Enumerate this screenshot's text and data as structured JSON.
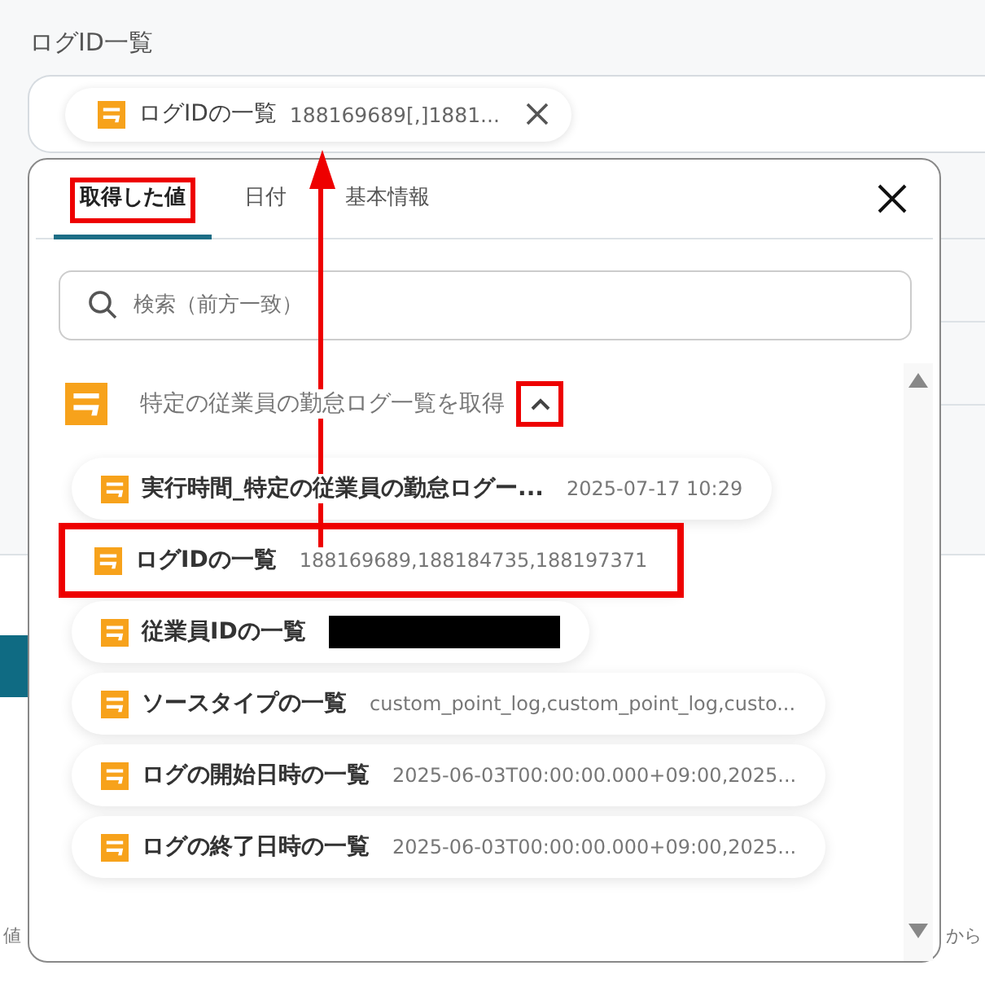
{
  "field": {
    "label": "ログID一覧",
    "chip": {
      "name": "ログIDの一覧",
      "value": "188169689[,]1881..."
    }
  },
  "popup": {
    "tabs": [
      {
        "label": "取得した値",
        "selected": true,
        "highlighted": true
      },
      {
        "label": "日付",
        "selected": false,
        "highlighted": false
      },
      {
        "label": "基本情報",
        "selected": false,
        "highlighted": false
      }
    ],
    "search": {
      "placeholder": "検索（前方一致）"
    },
    "group": {
      "title": "特定の従業員の勤怠ログ一覧を取得",
      "expanded": true,
      "highlighted": true
    },
    "items": [
      {
        "kind": "text",
        "name": "実行時間_特定の従業員の勤怠ログー...",
        "value": "2025-07-17 10:29",
        "highlighted": false
      },
      {
        "kind": "text",
        "name": "ログIDの一覧",
        "value": "188169689,188184735,188197371",
        "highlighted": true
      },
      {
        "kind": "redacted",
        "name": "従業員IDの一覧",
        "highlighted": false
      },
      {
        "kind": "text",
        "name": "ソースタイプの一覧",
        "value": "custom_point_log,custom_point_log,custo...",
        "highlighted": false
      },
      {
        "kind": "text",
        "name": "ログの開始日時の一覧",
        "value": "2025-06-03T00:00:00.000+09:00,2025...",
        "highlighted": false
      },
      {
        "kind": "text",
        "name": "ログの終了日時の一覧",
        "value": "2025-06-03T00:00:00.000+09:00,2025...",
        "highlighted": false
      }
    ]
  },
  "background_texts": [
    "値",
    "から"
  ]
}
